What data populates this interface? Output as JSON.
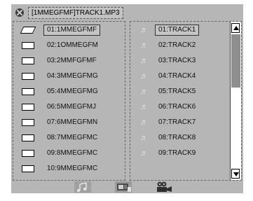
{
  "header": {
    "path": "[1MMEGFMF]TRACK1.MP3"
  },
  "folders": [
    {
      "label": "01:1MMEGFMF",
      "selected": true
    },
    {
      "label": "02:1OMMEGFM"
    },
    {
      "label": "03:2MMFGFMF"
    },
    {
      "label": "04:3MMEGFMG"
    },
    {
      "label": "05:4MMEGFMG"
    },
    {
      "label": "06:5MMEGFMJ"
    },
    {
      "label": "07:6MMEGFMN"
    },
    {
      "label": "08:7MMEGFMC"
    },
    {
      "label": "09:8MMEGFMC"
    },
    {
      "label": "10:9MMEGFMC"
    }
  ],
  "tracks": [
    {
      "label": "01:TRACK1",
      "selected": true
    },
    {
      "label": "02:TRACK2"
    },
    {
      "label": "03:TRACK3"
    },
    {
      "label": "04:TRACK4"
    },
    {
      "label": "05:TRACK5"
    },
    {
      "label": "06:TRACK6"
    },
    {
      "label": "07:TRACK7"
    },
    {
      "label": "08:TRACK8"
    },
    {
      "label": "09:TRACK9"
    }
  ],
  "icons": {
    "close": "close-circle-icon",
    "folder": "folder-icon",
    "note": "music-note-icon",
    "music_mode": "music-mode-icon",
    "photo_mode": "photo-mode-icon",
    "movie_mode": "movie-mode-icon"
  },
  "note_glyph": "♬",
  "colors": {
    "background": "#b6b6b6",
    "selected_text": "#111111"
  }
}
